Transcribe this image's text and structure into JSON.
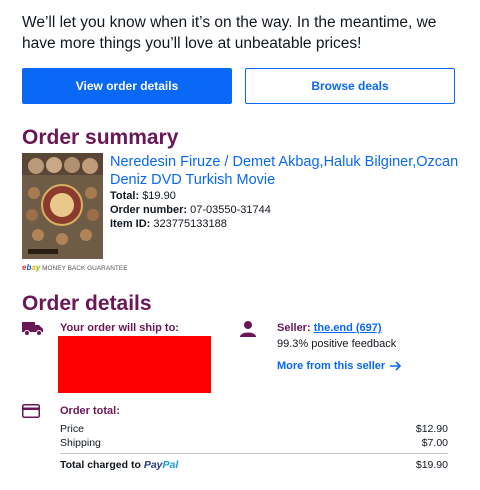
{
  "intro_text": "We’ll let you know when it’s on the way. In the meantime, we have more things you’ll love at unbeatable prices!",
  "buttons": {
    "view_order": "View order details",
    "browse_deals": "Browse deals"
  },
  "order_summary": {
    "heading": "Order summary",
    "item_title": "Neredesin Firuze / Demet Akbag,Haluk Bilginer,Ozcan Deniz DVD Turkish Movie",
    "total_label": "Total:",
    "total_value": "$19.90",
    "order_number_label": "Order number:",
    "order_number_value": "07-03550-31744",
    "item_id_label": "Item ID:",
    "item_id_value": "323775133188",
    "guarantee_logo": "ebay",
    "guarantee_text": "MONEY BACK GUARANTEE"
  },
  "order_details": {
    "heading": "Order details",
    "ship_label": "Your order will ship to:",
    "seller_label": "Seller:",
    "seller_name": "the.end (697)",
    "seller_feedback": "99.3% positive feedback",
    "more_from_seller": "More from this seller",
    "order_total_label": "Order total:",
    "price_label": "Price",
    "price_value": "$12.90",
    "shipping_label": "Shipping",
    "shipping_value": "$7.00",
    "total_charged_label": "Total charged to",
    "payment_method": "PayPal",
    "total_charged_value": "$19.90"
  },
  "icons": {
    "ship": "truck-icon",
    "seller": "person-icon",
    "total": "credit-card-icon",
    "arrow": "arrow-right-icon"
  },
  "colors": {
    "accent_blue": "#0968f6",
    "heading_purple": "#6a1657",
    "redaction": "#ff0000"
  }
}
